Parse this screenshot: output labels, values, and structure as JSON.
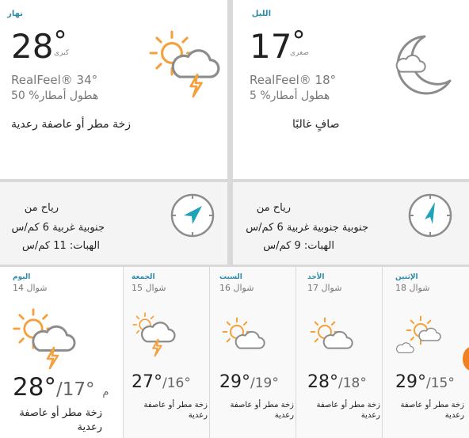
{
  "day": {
    "title": "نهار",
    "temp": "28",
    "deg": "°",
    "hi_lo_label": "كبرى",
    "realfeel": "RealFeel® 34°",
    "precip": "50 %هطول أمطار",
    "phrase": "زخة مطر أو عاصفة رعدية",
    "icon": "sun-cloud-thunder-icon"
  },
  "night": {
    "title": "الليل",
    "temp": "17",
    "deg": "°",
    "hi_lo_label": "صغرى",
    "realfeel": "RealFeel® 18°",
    "precip": "5 %هطول أمطار",
    "phrase": "صافٍ غالبًا",
    "icon": "moon-cloud-icon"
  },
  "wind_day": {
    "title": "رياح من",
    "direction": "جنوبية غربية 6 كم/س",
    "gust": "الهبات: 11 كم/س",
    "icon": "compass-icon"
  },
  "wind_night": {
    "title": "رياح من",
    "direction": "جنوبية جنوبية غربية 6 كم/س",
    "gust": "الهبات: 9 كم/س",
    "icon": "compass-icon"
  },
  "days": [
    {
      "name": "اليوم",
      "date": "شوال 14",
      "hi": "28°",
      "lo": "/17°",
      "unit": "م",
      "phrase": "زخة مطر أو عاصفة رعدية",
      "icon": "sun-cloud-thunder-icon"
    },
    {
      "name": "الجمعة",
      "date": "شوال 15",
      "hi": "27°",
      "lo": "/16°",
      "phrase": "زخة مطر أو عاصفة رعدية",
      "icon": "sun-cloud-thunder-icon"
    },
    {
      "name": "السبت",
      "date": "شوال 16",
      "hi": "29°",
      "lo": "/19°",
      "phrase": "زخة مطر أو عاصفة رعدية",
      "icon": "sun-cloud-icon"
    },
    {
      "name": "الأحد",
      "date": "شوال 17",
      "hi": "28°",
      "lo": "/18°",
      "phrase": "زخة مطر أو عاصفة رعدية",
      "icon": "sun-cloud-icon"
    },
    {
      "name": "الإثنين",
      "date": "شوال 18",
      "hi": "29°",
      "lo": "/15°",
      "phrase": "زخة مطر أو عاصفة رعدية",
      "icon": "sun-clouds-icon"
    }
  ],
  "colors": {
    "accent": "#2e8aa6",
    "sun": "#f5a03a",
    "compass_arrow": "#1ea3b8"
  }
}
